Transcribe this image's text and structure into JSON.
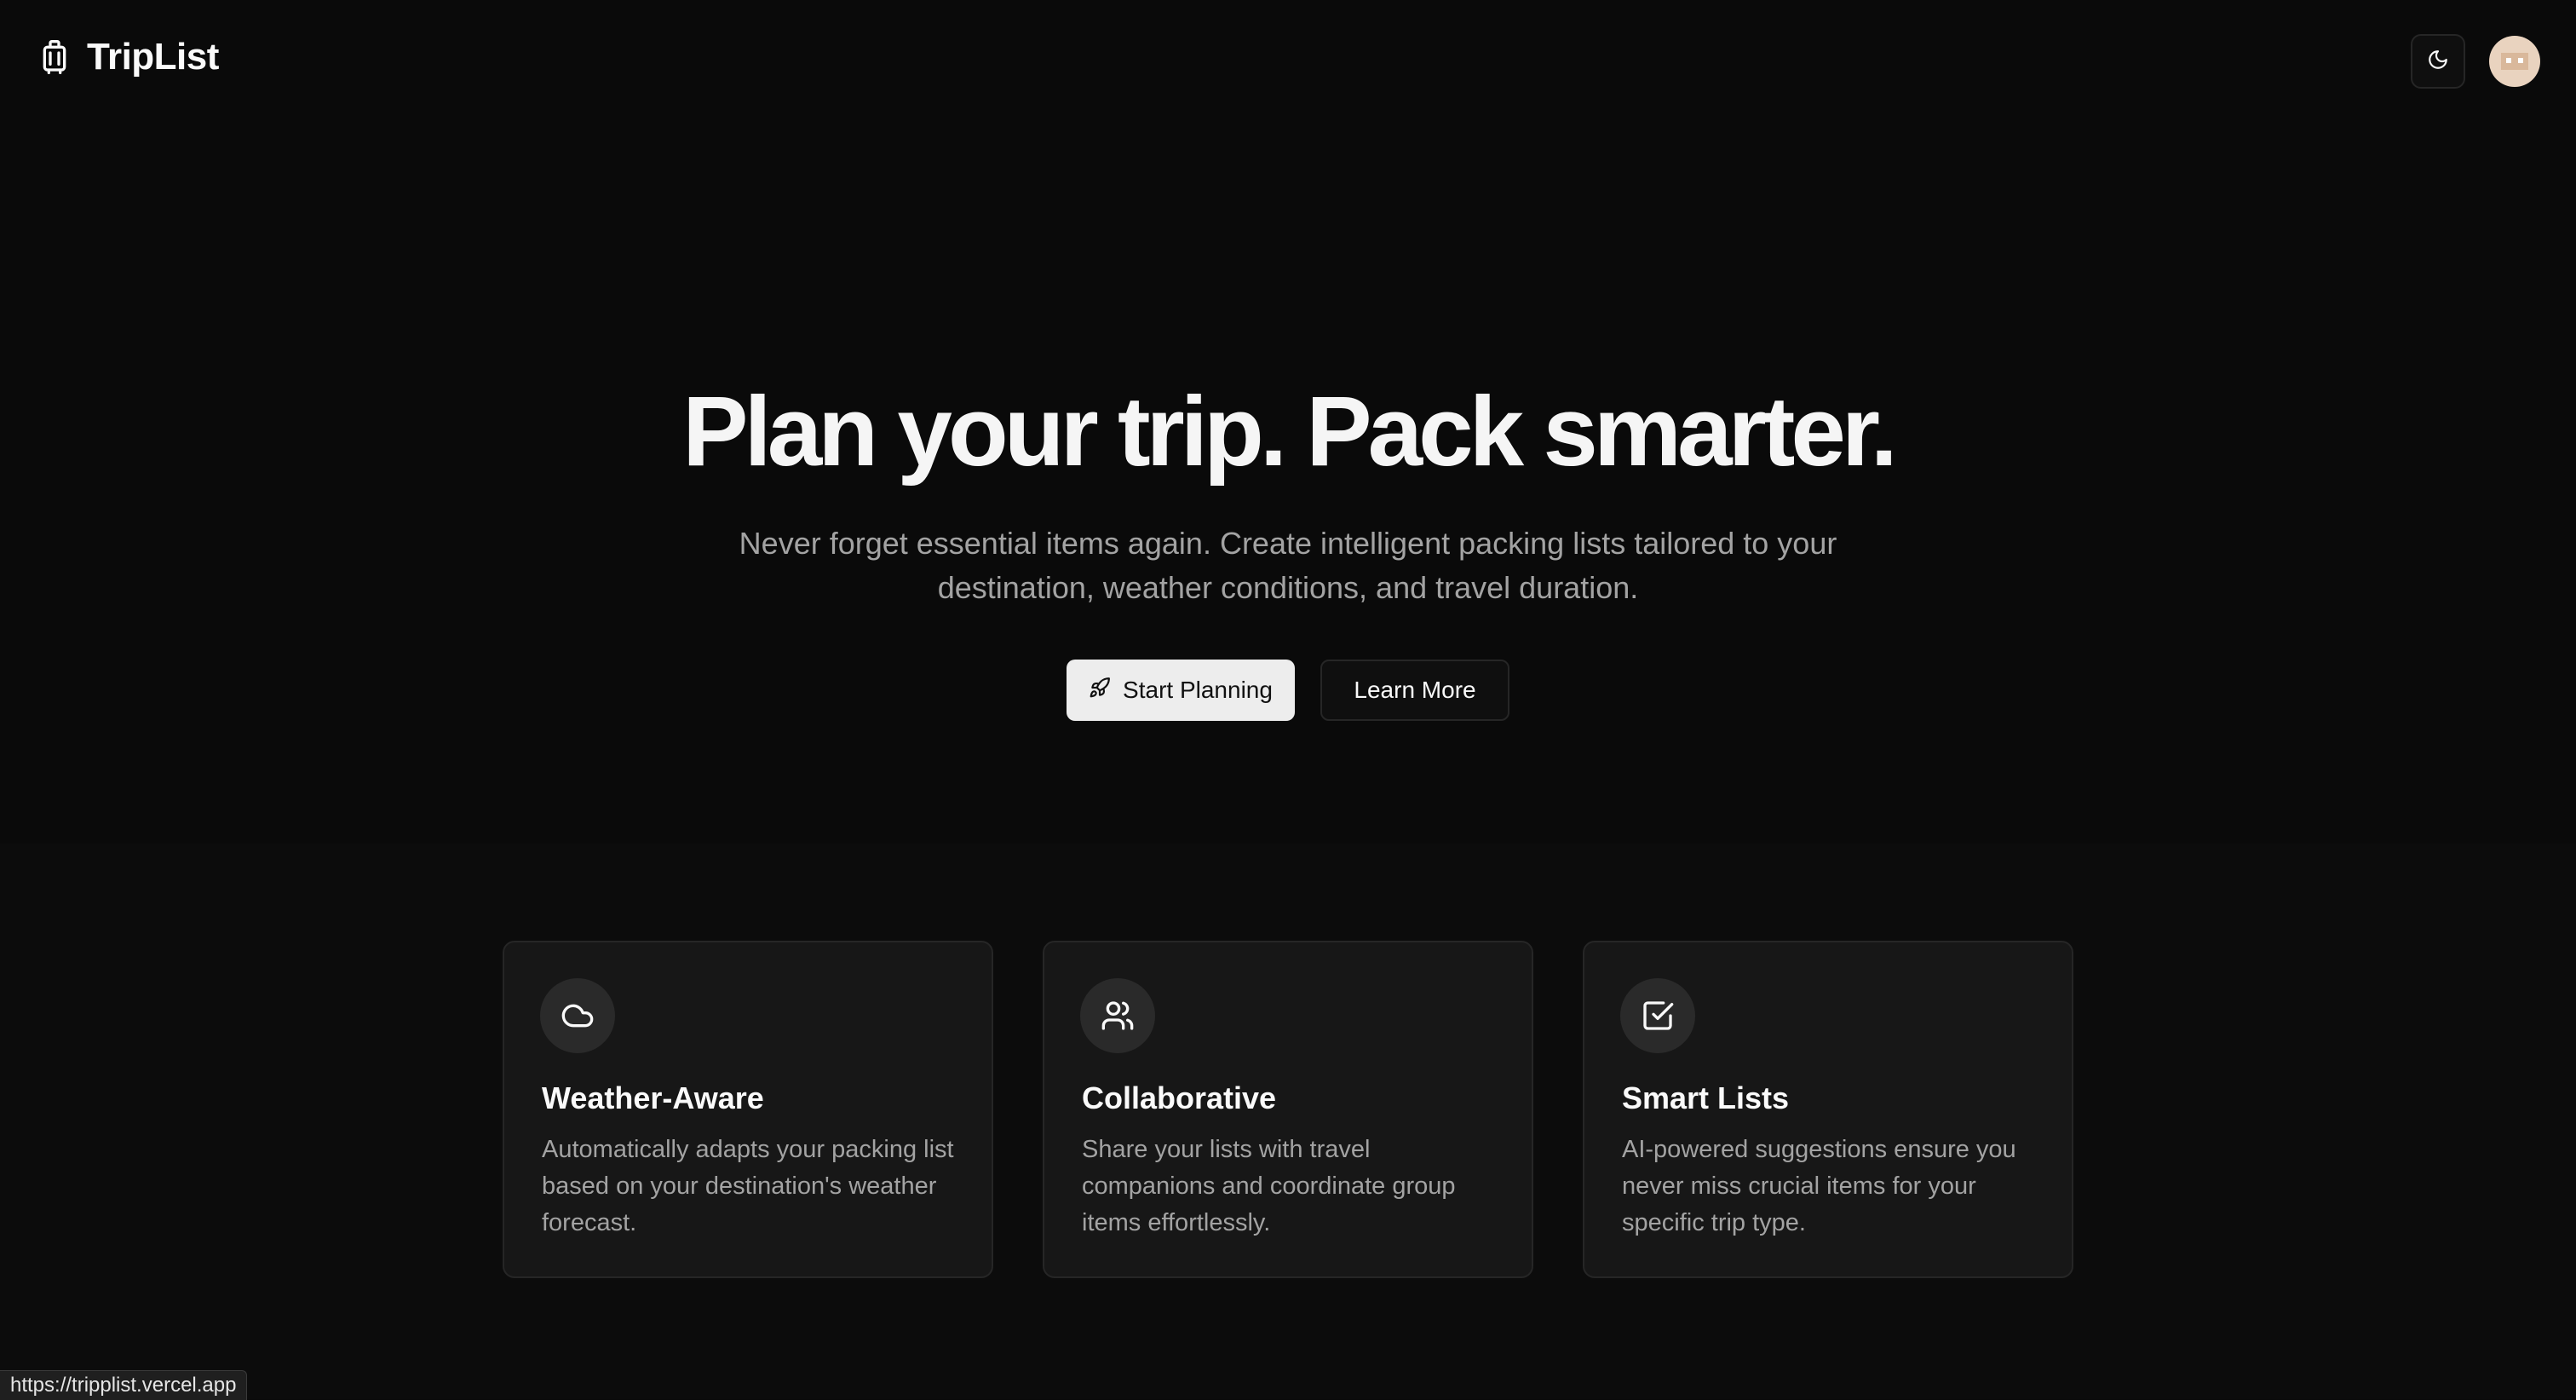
{
  "header": {
    "brand_name": "TripList",
    "logo_icon": "luggage-icon",
    "theme_toggle_icon": "moon-icon",
    "avatar_icon": "user-avatar"
  },
  "hero": {
    "title": "Plan your trip. Pack smarter.",
    "subtitle": "Never forget essential items again. Create intelligent packing lists tailored to your destination, weather conditions, and travel duration.",
    "primary_button": "Start Planning",
    "primary_button_icon": "rocket-icon",
    "secondary_button": "Learn More"
  },
  "features": [
    {
      "icon": "cloud-icon",
      "title": "Weather-Aware",
      "description": "Automatically adapts your packing list based on your destination's weather forecast."
    },
    {
      "icon": "users-icon",
      "title": "Collaborative",
      "description": "Share your lists with travel companions and coordinate group items effortlessly."
    },
    {
      "icon": "checkbox-icon",
      "title": "Smart Lists",
      "description": "AI-powered suggestions ensure you never miss crucial items for your specific trip type."
    }
  ],
  "status_bar": {
    "url": "https://tripplist.vercel.app"
  },
  "colors": {
    "background": "#0a0a0a",
    "card": "#171717",
    "primary_button": "#ededed",
    "muted_text": "#a3a3a3"
  }
}
